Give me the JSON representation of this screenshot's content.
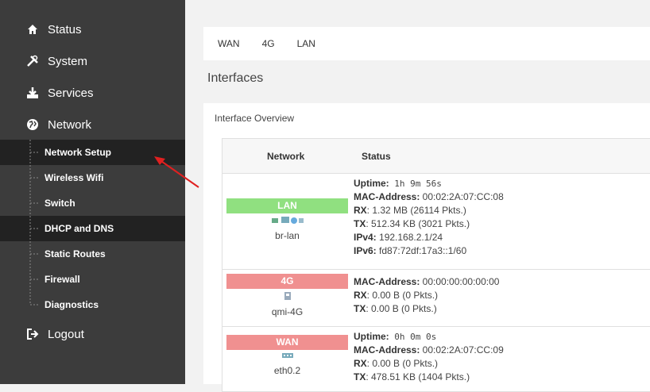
{
  "sidebar": {
    "main": [
      {
        "label": "Status",
        "icon": "home-icon"
      },
      {
        "label": "System",
        "icon": "tools-icon"
      },
      {
        "label": "Services",
        "icon": "download-icon"
      },
      {
        "label": "Network",
        "icon": "globe-icon"
      }
    ],
    "sub": [
      {
        "label": "Network Setup"
      },
      {
        "label": "Wireless Wifi"
      },
      {
        "label": "Switch"
      },
      {
        "label": "DHCP and DNS"
      },
      {
        "label": "Static Routes"
      },
      {
        "label": "Firewall"
      },
      {
        "label": "Diagnostics"
      }
    ],
    "logout": {
      "label": "Logout",
      "icon": "logout-icon"
    }
  },
  "tabs": [
    "WAN",
    "4G",
    "LAN"
  ],
  "page_title": "Interfaces",
  "panel_title": "Interface Overview",
  "table": {
    "headers": {
      "network": "Network",
      "status": "Status"
    },
    "rows": [
      {
        "name": "LAN",
        "color": "#90e080",
        "ifname": "br-lan",
        "lines": [
          {
            "k": "Uptime:",
            "v": " 1h 9m 56s",
            "mono": true
          },
          {
            "k": "MAC-Address:",
            "v": " 00:02:2A:07:CC:08",
            "mono": false
          },
          {
            "k": "RX",
            "v": ": 1.32 MB (26114 Pkts.)",
            "mono": false
          },
          {
            "k": "TX",
            "v": ": 512.34 KB (3021 Pkts.)",
            "mono": false
          },
          {
            "k": "IPv4:",
            "v": " 192.168.2.1/24",
            "mono": false
          },
          {
            "k": "IPv6:",
            "v": " fd87:72df:17a3::1/60",
            "mono": false
          }
        ]
      },
      {
        "name": "4G",
        "color": "#f09090",
        "ifname": "qmi-4G",
        "lines": [
          {
            "k": "MAC-Address:",
            "v": " 00:00:00:00:00:00",
            "mono": false
          },
          {
            "k": "RX",
            "v": ": 0.00 B (0 Pkts.)",
            "mono": false
          },
          {
            "k": "TX",
            "v": ": 0.00 B (0 Pkts.)",
            "mono": false
          }
        ]
      },
      {
        "name": "WAN",
        "color": "#f09090",
        "ifname": "eth0.2",
        "lines": [
          {
            "k": "Uptime:",
            "v": " 0h 0m 0s",
            "mono": true
          },
          {
            "k": "MAC-Address:",
            "v": " 00:02:2A:07:CC:09",
            "mono": false
          },
          {
            "k": "RX",
            "v": ": 0.00 B (0 Pkts.)",
            "mono": false
          },
          {
            "k": "TX",
            "v": ": 478.51 KB (1404 Pkts.)",
            "mono": false
          }
        ]
      }
    ]
  },
  "colors": {
    "sidebar": "#3c3c3c",
    "selected": "#222222",
    "arrow": "#e02020"
  }
}
